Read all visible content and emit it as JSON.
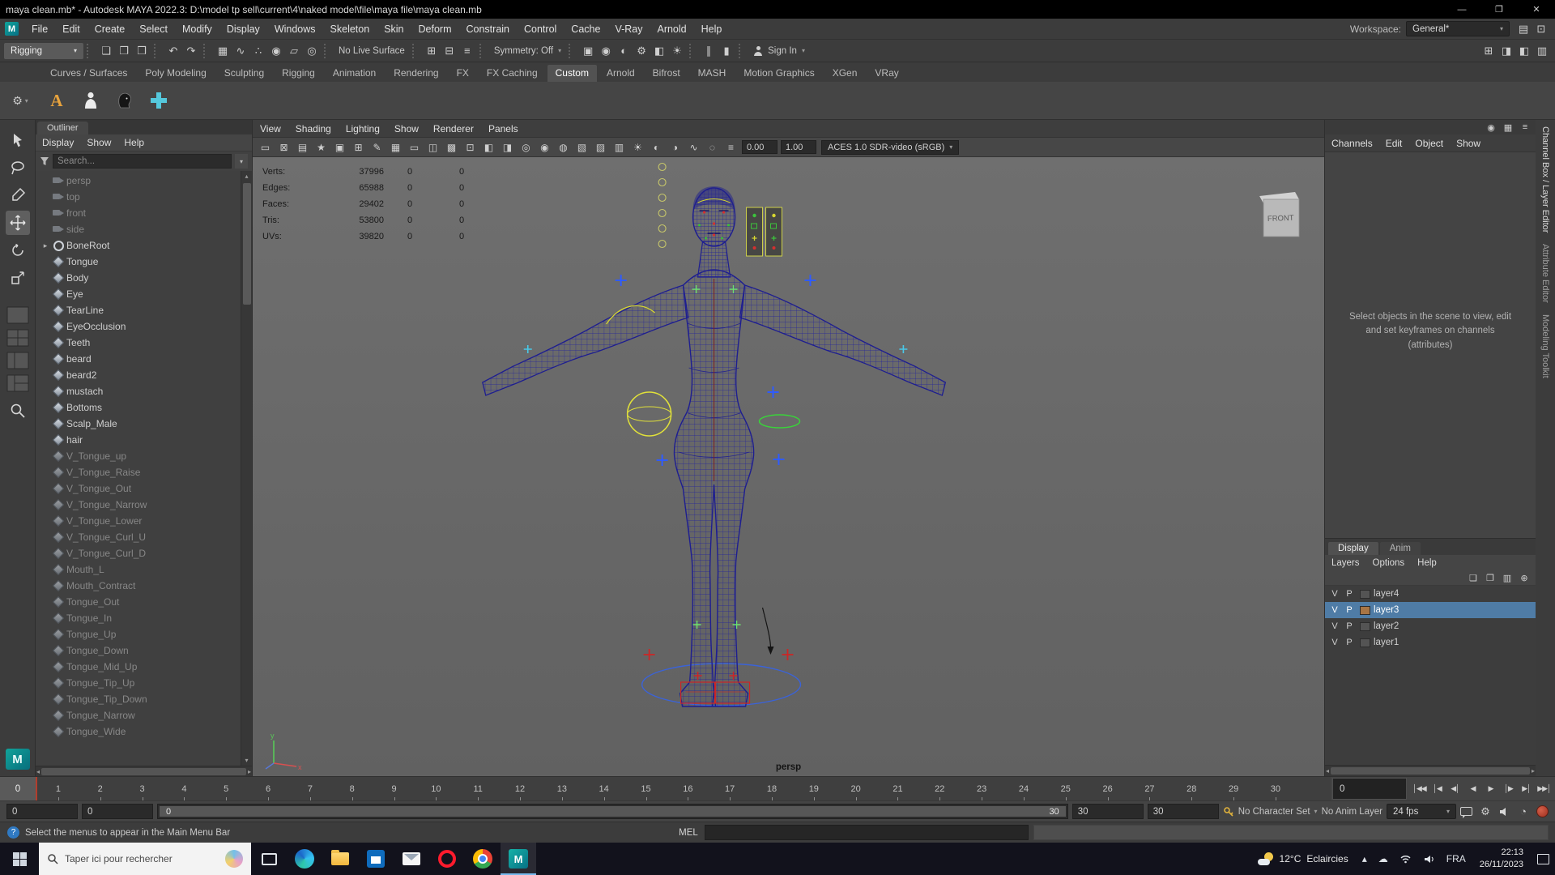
{
  "colors": {
    "selection_blue": "#4f7ca6",
    "wireframe_navy": "#1e1e90",
    "arnold_orange": "#e8a33d",
    "maya_teal": "#11a39a",
    "autokey_red": "#9e2f1f",
    "taskbar_dark": "#12121c",
    "viewport_gray": "#696969"
  },
  "titlebar": {
    "title": "maya clean.mb* - Autodesk MAYA 2022.3: D:\\model tp sell\\current\\4\\naked model\\file\\maya file\\maya clean.mb",
    "window_buttons": [
      {
        "name": "minimize-button",
        "glyph": "—"
      },
      {
        "name": "maximize-button",
        "glyph": "❐"
      },
      {
        "name": "close-button",
        "glyph": "✕"
      }
    ]
  },
  "menubar": {
    "items": [
      "File",
      "Edit",
      "Create",
      "Select",
      "Modify",
      "Display",
      "Windows",
      "Skeleton",
      "Skin",
      "Deform",
      "Constrain",
      "Control",
      "Cache",
      "V-Ray",
      "Arnold",
      "Help"
    ],
    "workspace_label": "Workspace:",
    "workspace_value": "General*",
    "right_icons": [
      {
        "name": "workspace-save-icon",
        "glyph": "▤"
      },
      {
        "name": "workspace-lock-icon",
        "glyph": "⊡"
      }
    ]
  },
  "statusline": {
    "mode": "Rigging",
    "file_icons": [
      {
        "name": "new-scene-icon",
        "glyph": "❏"
      },
      {
        "name": "open-scene-icon",
        "glyph": "❐"
      },
      {
        "name": "save-scene-icon",
        "glyph": "❒"
      }
    ],
    "undo_icons": [
      {
        "name": "undo-icon",
        "glyph": "↶"
      },
      {
        "name": "redo-icon",
        "glyph": "↷"
      }
    ],
    "snap_icons": [
      {
        "name": "snap-to-grids-icon",
        "glyph": "▦"
      },
      {
        "name": "snap-to-curves-icon",
        "glyph": "∿"
      },
      {
        "name": "snap-to-points-icon",
        "glyph": "∴"
      },
      {
        "name": "snap-to-projected-center-icon",
        "glyph": "◉"
      },
      {
        "name": "snap-to-view-planes-icon",
        "glyph": "▱"
      },
      {
        "name": "make-object-live-icon",
        "glyph": "◎"
      }
    ],
    "no_live_surface": "No Live Surface",
    "history_icons": [
      {
        "name": "input-connections-icon",
        "glyph": "⊞"
      },
      {
        "name": "output-connections-icon",
        "glyph": "⊟"
      },
      {
        "name": "construction-history-icon",
        "glyph": "≡"
      }
    ],
    "symmetry": "Symmetry: Off",
    "render_icons": [
      {
        "name": "render-view-icon",
        "glyph": "▣"
      },
      {
        "name": "render-current-frame-icon",
        "glyph": "◉"
      },
      {
        "name": "ipr-render-icon",
        "glyph": "◐"
      },
      {
        "name": "render-settings-icon",
        "glyph": "⚙"
      },
      {
        "name": "hypershade-icon",
        "glyph": "◧"
      },
      {
        "name": "light-editor-icon",
        "glyph": "☀"
      }
    ],
    "pause_icons": [
      {
        "name": "pause-evaluation-icon",
        "glyph": "∥"
      },
      {
        "name": "evaluation-mode-icon",
        "glyph": "▮"
      }
    ],
    "sign_in": "Sign In",
    "panel_toggle_icons": [
      {
        "name": "modeling-toolkit-toggle-icon",
        "glyph": "⊞"
      },
      {
        "name": "attribute-editor-toggle-icon",
        "glyph": "◨"
      },
      {
        "name": "tool-settings-toggle-icon",
        "glyph": "◧"
      },
      {
        "name": "channel-box-toggle-icon",
        "glyph": "▥"
      }
    ]
  },
  "shelf": {
    "gear_icon": "⚙",
    "arnold_label": "A",
    "tabs": [
      {
        "label": "Curves / Surfaces"
      },
      {
        "label": "Poly Modeling"
      },
      {
        "label": "Sculpting"
      },
      {
        "label": "Rigging"
      },
      {
        "label": "Animation"
      },
      {
        "label": "Rendering"
      },
      {
        "label": "FX"
      },
      {
        "label": "FX Caching"
      },
      {
        "label": "Custom",
        "active": true
      },
      {
        "label": "Arnold"
      },
      {
        "label": "Bifrost"
      },
      {
        "label": "MASH"
      },
      {
        "label": "Motion Graphics"
      },
      {
        "label": "XGen"
      },
      {
        "label": "VRay"
      }
    ]
  },
  "outliner": {
    "panel_title": "Outliner",
    "menus": [
      "Display",
      "Show",
      "Help"
    ],
    "search_placeholder": "Search...",
    "items": [
      {
        "label": "persp",
        "icon": "camera",
        "dim": true
      },
      {
        "label": "top",
        "icon": "camera",
        "dim": true
      },
      {
        "label": "front",
        "icon": "camera",
        "dim": true
      },
      {
        "label": "side",
        "icon": "camera",
        "dim": true
      },
      {
        "label": "BoneRoot",
        "icon": "joint",
        "expand": true
      },
      {
        "label": "Tongue",
        "icon": "mesh"
      },
      {
        "label": "Body",
        "icon": "mesh"
      },
      {
        "label": "Eye",
        "icon": "mesh"
      },
      {
        "label": "TearLine",
        "icon": "mesh"
      },
      {
        "label": "EyeOcclusion",
        "icon": "mesh"
      },
      {
        "label": "Teeth",
        "icon": "mesh"
      },
      {
        "label": "beard",
        "icon": "mesh"
      },
      {
        "label": "beard2",
        "icon": "mesh"
      },
      {
        "label": "mustach",
        "icon": "mesh"
      },
      {
        "label": "Bottoms",
        "icon": "mesh"
      },
      {
        "label": "Scalp_Male",
        "icon": "mesh"
      },
      {
        "label": "hair",
        "icon": "mesh"
      },
      {
        "label": "V_Tongue_up",
        "icon": "mesh",
        "dim": true
      },
      {
        "label": "V_Tongue_Raise",
        "icon": "mesh",
        "dim": true
      },
      {
        "label": "V_Tongue_Out",
        "icon": "mesh",
        "dim": true
      },
      {
        "label": "V_Tongue_Narrow",
        "icon": "mesh",
        "dim": true
      },
      {
        "label": "V_Tongue_Lower",
        "icon": "mesh",
        "dim": true
      },
      {
        "label": "V_Tongue_Curl_U",
        "icon": "mesh",
        "dim": true
      },
      {
        "label": "V_Tongue_Curl_D",
        "icon": "mesh",
        "dim": true
      },
      {
        "label": "Mouth_L",
        "icon": "mesh",
        "dim": true
      },
      {
        "label": "Mouth_Contract",
        "icon": "mesh",
        "dim": true
      },
      {
        "label": "Tongue_Out",
        "icon": "mesh",
        "dim": true
      },
      {
        "label": "Tongue_In",
        "icon": "mesh",
        "dim": true
      },
      {
        "label": "Tongue_Up",
        "icon": "mesh",
        "dim": true
      },
      {
        "label": "Tongue_Down",
        "icon": "mesh",
        "dim": true
      },
      {
        "label": "Tongue_Mid_Up",
        "icon": "mesh",
        "dim": true
      },
      {
        "label": "Tongue_Tip_Up",
        "icon": "mesh",
        "dim": true
      },
      {
        "label": "Tongue_Tip_Down",
        "icon": "mesh",
        "dim": true
      },
      {
        "label": "Tongue_Narrow",
        "icon": "mesh",
        "dim": true
      },
      {
        "label": "Tongue_Wide",
        "icon": "mesh",
        "dim": true
      }
    ]
  },
  "viewport": {
    "menus": [
      "View",
      "Shading",
      "Lighting",
      "Show",
      "Renderer",
      "Panels"
    ],
    "hud": [
      {
        "label": "Verts:",
        "value": "37996",
        "z1": "0",
        "z2": "0"
      },
      {
        "label": "Edges:",
        "value": "65988",
        "z1": "0",
        "z2": "0"
      },
      {
        "label": "Faces:",
        "value": "29402",
        "z1": "0",
        "z2": "0"
      },
      {
        "label": "Tris:",
        "value": "53800",
        "z1": "0",
        "z2": "0"
      },
      {
        "label": "UVs:",
        "value": "39820",
        "z1": "0",
        "z2": "0"
      }
    ],
    "icons": [
      {
        "name": "select-camera-icon",
        "glyph": "▭"
      },
      {
        "name": "lock-camera-icon",
        "glyph": "⊠"
      },
      {
        "name": "camera-attributes-icon",
        "glyph": "▤"
      },
      {
        "name": "bookmarks-icon",
        "glyph": "★"
      },
      {
        "name": "image-plane-icon",
        "glyph": "▣"
      },
      {
        "name": "two-d-pan-zoom-icon",
        "glyph": "⊞"
      },
      {
        "name": "grease-pencil-icon",
        "glyph": "✎"
      },
      {
        "name": "grid-icon",
        "glyph": "▦"
      },
      {
        "name": "film-gate-icon",
        "glyph": "▭"
      },
      {
        "name": "resolution-gate-icon",
        "glyph": "◫"
      },
      {
        "name": "gate-mask-icon",
        "glyph": "▩"
      },
      {
        "name": "field-chart-icon",
        "glyph": "⊡"
      },
      {
        "name": "safe-action-icon",
        "glyph": "◧"
      },
      {
        "name": "safe-title-icon",
        "glyph": "◨"
      },
      {
        "name": "frame-all-icon",
        "glyph": "◎"
      },
      {
        "name": "frame-selection-icon",
        "glyph": "◉"
      },
      {
        "name": "default-material-icon",
        "glyph": "◍"
      },
      {
        "name": "wireframe-display-icon",
        "glyph": "▧"
      },
      {
        "name": "smooth-shade-icon",
        "glyph": "▨"
      },
      {
        "name": "textured-display-icon",
        "glyph": "▥"
      },
      {
        "name": "use-all-lights-icon",
        "glyph": "☀"
      },
      {
        "name": "shadows-icon",
        "glyph": "◐"
      },
      {
        "name": "screen-space-ao-icon",
        "glyph": "◑"
      },
      {
        "name": "anti-aliasing-icon",
        "glyph": "∿"
      },
      {
        "name": "depth-of-field-icon",
        "glyph": "◌"
      },
      {
        "name": "motion-blur-icon",
        "glyph": "≡"
      }
    ],
    "exposure": "0.00",
    "gamma": "1.00",
    "colorspace": "ACES 1.0 SDR-video (sRGB)",
    "camera_label": "persp",
    "image_plane_label": "FRONT"
  },
  "channelbox": {
    "top_icons": [
      {
        "name": "pin-panel-icon",
        "glyph": "◉"
      },
      {
        "name": "panel-layout-icon",
        "glyph": "▦"
      },
      {
        "name": "panel-menu-icon",
        "glyph": "≡"
      }
    ],
    "menus": [
      "Channels",
      "Edit",
      "Object",
      "Show"
    ],
    "empty_text": "Select objects in the scene to view, edit and set keyframes on channels (attributes)"
  },
  "sidestrip": {
    "tabs": [
      {
        "label": "Channel Box / Layer Editor",
        "active": true
      },
      {
        "label": "Attribute Editor"
      },
      {
        "label": "Modeling Toolkit"
      }
    ]
  },
  "layer_editor": {
    "tabs": [
      {
        "label": "Display",
        "active": true
      },
      {
        "label": "Anim"
      }
    ],
    "menus": [
      "Layers",
      "Options",
      "Help"
    ],
    "icons": [
      {
        "name": "new-empty-layer-icon",
        "glyph": "❏"
      },
      {
        "name": "new-layer-from-selected-icon",
        "glyph": "❐"
      },
      {
        "name": "layer-options-icon",
        "glyph": "▥"
      },
      {
        "name": "add-layer-icon",
        "glyph": "⊕"
      }
    ],
    "layers": [
      {
        "v": "V",
        "p": "P",
        "name": "layer4"
      },
      {
        "v": "V",
        "p": "P",
        "name": "layer3",
        "selected": true,
        "swatch": "#a87545"
      },
      {
        "v": "V",
        "p": "P",
        "name": "layer2"
      },
      {
        "v": "V",
        "p": "P",
        "name": "layer1"
      }
    ]
  },
  "timeline": {
    "current_frame": "0",
    "ticks": [
      "1",
      "2",
      "3",
      "4",
      "5",
      "6",
      "7",
      "8",
      "9",
      "10",
      "11",
      "12",
      "13",
      "14",
      "15",
      "16",
      "17",
      "18",
      "19",
      "20",
      "21",
      "22",
      "23",
      "24",
      "25",
      "26",
      "27",
      "28",
      "29",
      "30"
    ],
    "current_time_field": "0",
    "playback_buttons": [
      {
        "name": "go-to-start-button",
        "glyph": "│◀◀"
      },
      {
        "name": "step-back-frame-button",
        "glyph": "│◀"
      },
      {
        "name": "step-back-key-button",
        "glyph": "◀│"
      },
      {
        "name": "play-backwards-button",
        "glyph": "◀"
      },
      {
        "name": "play-forwards-button",
        "glyph": "▶"
      },
      {
        "name": "step-forward-key-button",
        "glyph": "│▶"
      },
      {
        "name": "step-forward-frame-button",
        "glyph": "▶│"
      },
      {
        "name": "go-to-end-button",
        "glyph": "▶▶│"
      }
    ]
  },
  "range_slider": {
    "animation_start": "0",
    "playback_start": "0",
    "bar_start_label": "0",
    "bar_end_label": "30",
    "playback_end": "30",
    "animation_end": "30",
    "character_set": "No Character Set",
    "anim_layer": "No Anim Layer",
    "fps": "24 fps"
  },
  "command_line": {
    "help_text": "Select the menus to appear in the Main Menu Bar",
    "mel_label": "MEL"
  },
  "taskbar": {
    "search_placeholder": "Taper ici pour rechercher",
    "weather_temp": "12°C",
    "weather_text": "Eclaircies",
    "chevron": "▴",
    "cloud_icon": "☁",
    "lang": "FRA",
    "time": "22:13",
    "date": "26/11/2023"
  }
}
